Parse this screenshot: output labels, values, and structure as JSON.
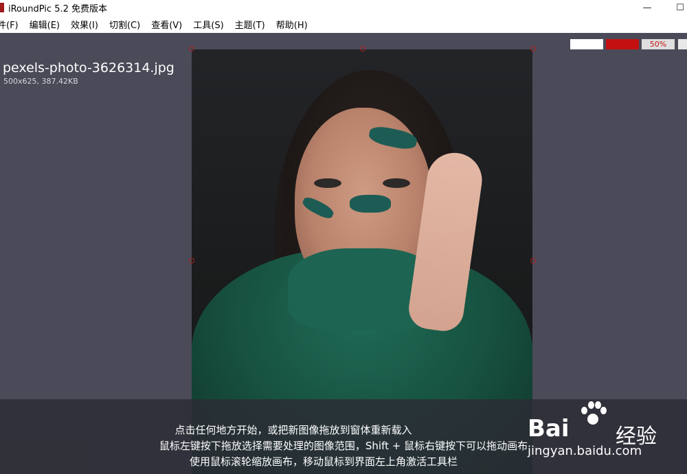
{
  "window": {
    "title": "iRoundPic 5.2 免费版本",
    "minimize_symbol": "—",
    "maximize_symbol": "☐"
  },
  "menu": {
    "items": [
      "件(F)",
      "编辑(E)",
      "效果(I)",
      "切割(C)",
      "查看(V)",
      "工具(S)",
      "主题(T)",
      "帮助(H)"
    ]
  },
  "image_info": {
    "file_name": "pexels-photo-3626314.jpg",
    "details": "500x625, 387.42KB"
  },
  "toolbar": {
    "zoom_label": "50%",
    "colors": {
      "swatch1": "#ffffff",
      "swatch2": "#c41010"
    }
  },
  "hints": {
    "line1": "点击任何地方开始，或把新图像拖放到窗体重新载入",
    "line2": "鼠标左键按下拖放选择需要处理的图像范围，Shift + 鼠标右键按下可以拖动画布",
    "line3": "使用鼠标滚轮缩放画布，移动鼠标到界面左上角激活工具栏"
  },
  "watermark": {
    "brand": "Bai",
    "brand_suffix": "经验",
    "url": "jingyan.baidu.com"
  },
  "colors": {
    "canvas_bg": "#4a4a58",
    "accent_red": "#c41010"
  }
}
